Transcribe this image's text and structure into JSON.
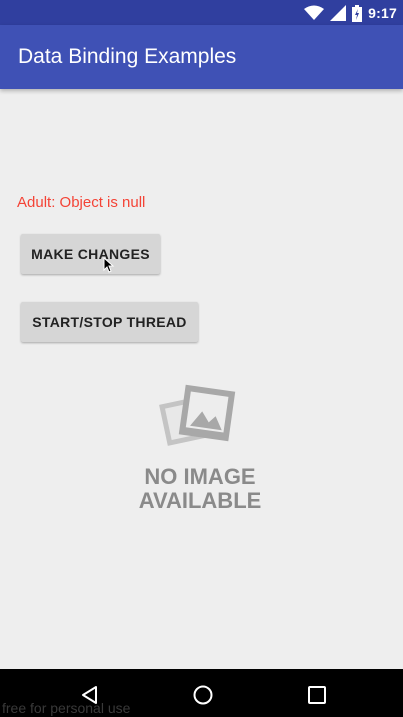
{
  "status_bar": {
    "time": "9:17",
    "icons": [
      "wifi-icon",
      "signal-icon",
      "battery-icon"
    ]
  },
  "app_bar": {
    "title": "Data Binding Examples"
  },
  "content": {
    "adult_text": "Adult: Object is null",
    "make_changes_label": "MAKE CHANGES",
    "thread_label": "START/STOP THREAD",
    "placeholder_image": {
      "line1": "NO IMAGE",
      "line2": "AVAILABLE"
    }
  },
  "nav_bar": {
    "buttons": [
      "back-icon",
      "home-icon",
      "recents-icon"
    ]
  },
  "watermark": "free for personal use",
  "colors": {
    "status_bar": "#303f9f",
    "app_bar": "#3f51b5",
    "error_text": "#f44336",
    "background": "#eeeeee",
    "button": "#d6d6d6"
  }
}
